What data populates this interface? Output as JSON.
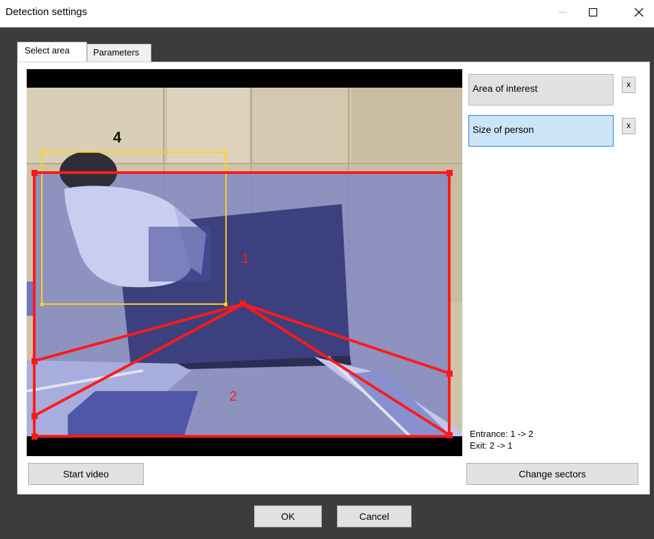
{
  "window": {
    "title": "Detection settings"
  },
  "tabs": [
    {
      "label": "Select area"
    },
    {
      "label": "Parameters"
    }
  ],
  "zones": [
    {
      "label": "Area of interest"
    },
    {
      "label": "Size of person"
    }
  ],
  "zone_remove_label": "x",
  "overlay_labels": {
    "person_box": "4",
    "sector_1": "1",
    "sector_2": "2"
  },
  "direction_info": {
    "entrance": "Entrance: 1 -> 2",
    "exit": "Exit: 2 -> 1"
  },
  "buttons": {
    "start_video": "Start video",
    "change_sectors": "Change sectors",
    "ok": "OK",
    "cancel": "Cancel"
  },
  "colors": {
    "sector_line": "#ff1a1a",
    "person_box": "#ffd21a",
    "selected_zone": "#cce4f7",
    "dialog_frame": "#3c3c3c"
  },
  "icons": {
    "minimize": "minimize-icon",
    "maximize": "maximize-icon",
    "close": "close-icon"
  }
}
